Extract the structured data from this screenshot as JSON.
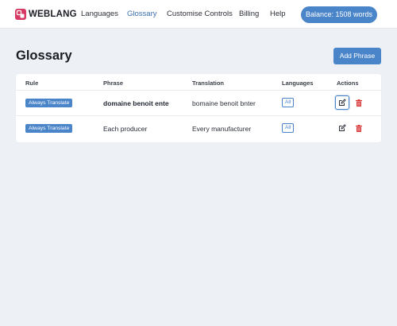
{
  "brand": {
    "name": "WEBLANG",
    "logo_color": "#d63a63"
  },
  "nav": {
    "items": [
      {
        "label": "Languages",
        "active": false
      },
      {
        "label": "Glossary",
        "active": true
      },
      {
        "label": "Customise Controls",
        "active": false
      },
      {
        "label": "Billing",
        "active": false
      },
      {
        "label": "Help",
        "active": false
      }
    ],
    "balance_label": "Balance: 1508 words"
  },
  "page": {
    "title": "Glossary",
    "add_button_label": "Add Phrase"
  },
  "table": {
    "columns": [
      "Rule",
      "Phrase",
      "Translation",
      "Languages",
      "Actions"
    ],
    "rows": [
      {
        "rule": "Always Translate",
        "phrase": "domaine benoit ente",
        "translation": "bomaine benoit bnter",
        "languages": "All",
        "icons": [
          "edit-icon",
          "trash-icon"
        ]
      },
      {
        "rule": "Always Translate",
        "phrase": "Each producer",
        "translation": "Every manufacturer",
        "languages": "All",
        "icons": [
          "edit-icon",
          "trash-icon"
        ]
      }
    ]
  },
  "colors": {
    "accent": "#4a84c9",
    "active_nav": "#3a6fb0",
    "delete": "#d9383a",
    "background": "#edf0f5"
  }
}
